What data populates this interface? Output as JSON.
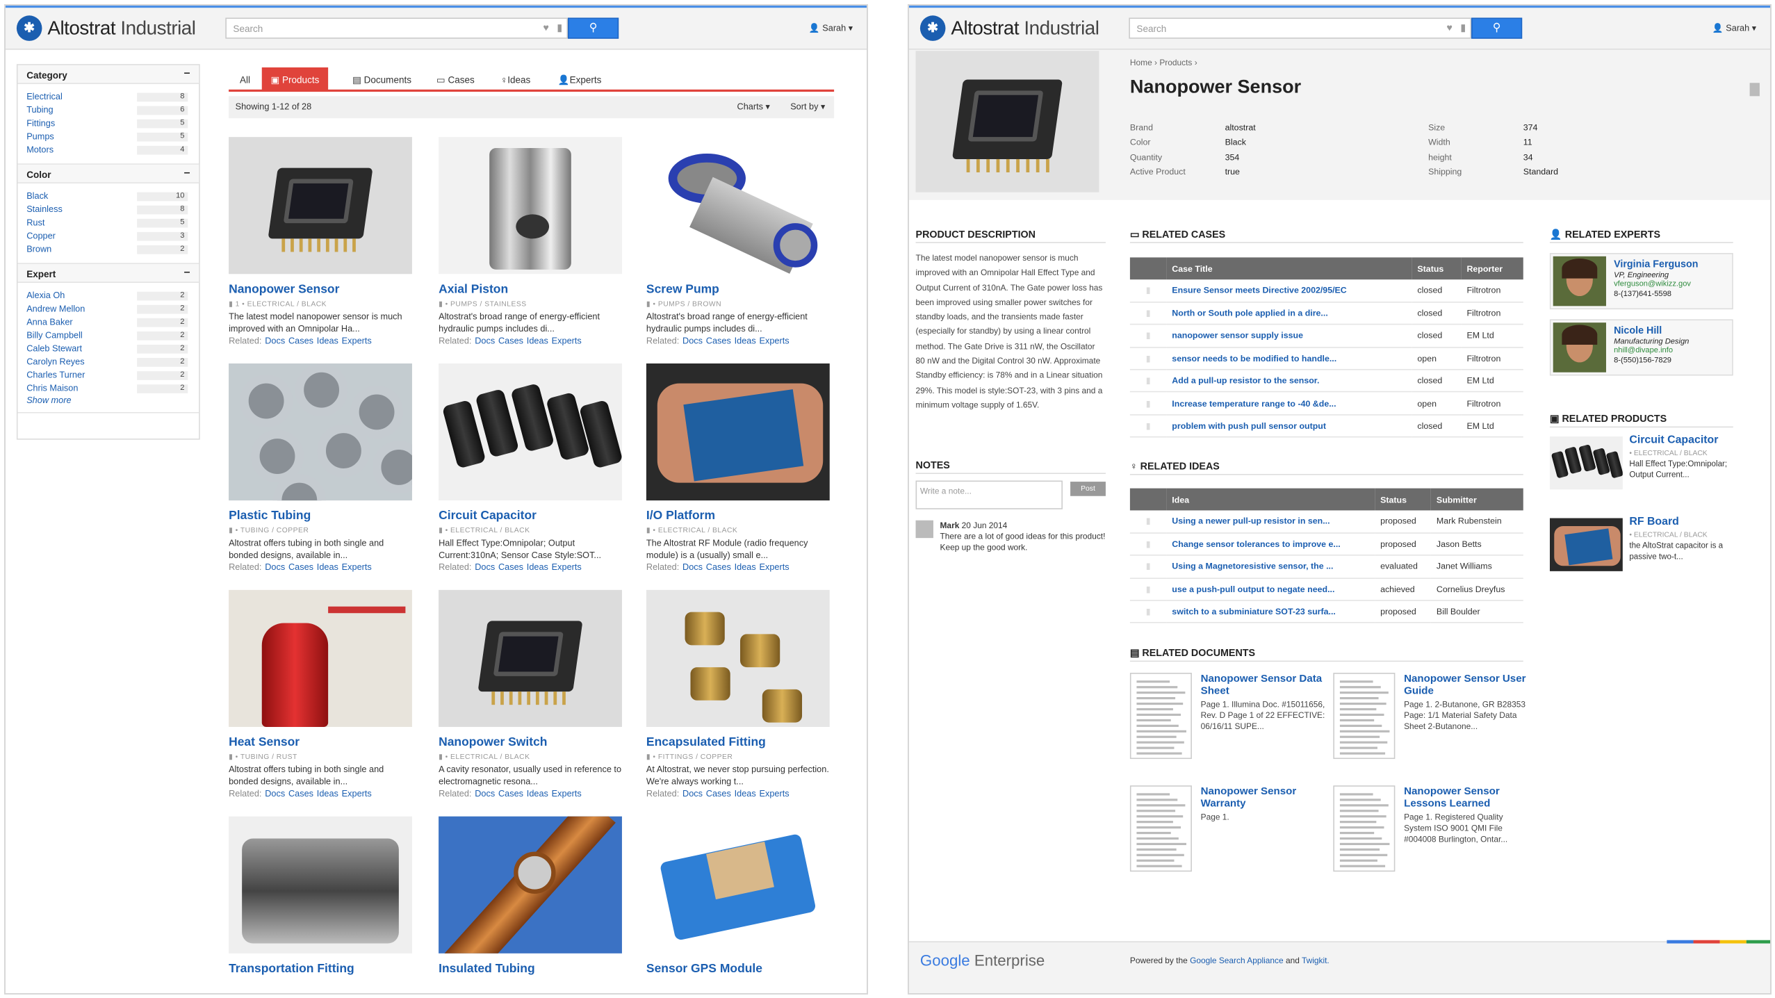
{
  "app": {
    "brand_main": "Altostrat",
    "brand_sub": "Industrial",
    "search_placeholder": "Search",
    "user": "Sarah"
  },
  "left": {
    "facets": [
      {
        "title": "Category",
        "items": [
          {
            "label": "Electrical",
            "count": "8"
          },
          {
            "label": "Tubing",
            "count": "6"
          },
          {
            "label": "Fittings",
            "count": "5"
          },
          {
            "label": "Pumps",
            "count": "5"
          },
          {
            "label": "Motors",
            "count": "4"
          }
        ]
      },
      {
        "title": "Color",
        "items": [
          {
            "label": "Black",
            "count": "10"
          },
          {
            "label": "Stainless",
            "count": "8"
          },
          {
            "label": "Rust",
            "count": "5"
          },
          {
            "label": "Copper",
            "count": "3"
          },
          {
            "label": "Brown",
            "count": "2"
          }
        ]
      },
      {
        "title": "Expert",
        "items": [
          {
            "label": "Alexia Oh",
            "count": "2"
          },
          {
            "label": "Andrew Mellon",
            "count": "2"
          },
          {
            "label": "Anna Baker",
            "count": "2"
          },
          {
            "label": "Billy Campbell",
            "count": "2"
          },
          {
            "label": "Caleb Stewart",
            "count": "2"
          },
          {
            "label": "Carolyn Reyes",
            "count": "2"
          },
          {
            "label": "Charles Turner",
            "count": "2"
          },
          {
            "label": "Chris Maison",
            "count": "2"
          }
        ]
      }
    ],
    "show_more": "Show more",
    "tabs": {
      "all": "All",
      "products": "Products",
      "documents": "Documents",
      "cases": "Cases",
      "ideas": "Ideas",
      "experts": "Experts"
    },
    "showing": "Showing 1-12 of 28",
    "charts": "Charts",
    "sort_by": "Sort by",
    "related_label": "Related:",
    "related_links": [
      "Docs",
      "Cases",
      "Ideas",
      "Experts"
    ],
    "products": [
      {
        "title": "Nanopower Sensor",
        "meta": "1 • ELECTRICAL / BLACK",
        "desc": "The latest model nanopower sensor is much improved with an Omnipolar Ha...",
        "img": "chip"
      },
      {
        "title": "Axial Piston",
        "meta": "• PUMPS / STAINLESS",
        "desc": "Altostrat's broad range of energy-efficient hydraulic pumps includes di...",
        "img": "piston"
      },
      {
        "title": "Screw Pump",
        "meta": "• PUMPS / BROWN",
        "desc": "Altostrat's broad range of energy-efficient hydraulic pumps includes di...",
        "img": "pump"
      },
      {
        "title": "Plastic Tubing",
        "meta": "• TUBING / COPPER",
        "desc": "Altostrat offers tubing in both single and bonded designs, available in...",
        "img": "tubing"
      },
      {
        "title": "Circuit Capacitor",
        "meta": "• ELECTRICAL / BLACK",
        "desc": "Hall Effect Type:Omnipolar; Output Current:310nA; Sensor Case Style:SOT...",
        "img": "caps"
      },
      {
        "title": "I/O Platform",
        "meta": "• ELECTRICAL / BLACK",
        "desc": "The Altostrat RF Module (radio frequency module) is a (usually) small e...",
        "img": "board"
      },
      {
        "title": "Heat Sensor",
        "meta": "• TUBING / RUST",
        "desc": "Altostrat offers tubing in both single and bonded designs, available in...",
        "img": "tank"
      },
      {
        "title": "Nanopower Switch",
        "meta": "• ELECTRICAL / BLACK",
        "desc": "A cavity resonator, usually used in reference to electromagnetic resona...",
        "img": "chip"
      },
      {
        "title": "Encapsulated Fitting",
        "meta": "• FITTINGS / COPPER",
        "desc": "At Altostrat, we never stop pursuing perfection. We're always working t...",
        "img": "fittings"
      },
      {
        "title": "Transportation Fitting",
        "meta": "",
        "desc": "",
        "img": "engine"
      },
      {
        "title": "Insulated Tubing",
        "meta": "",
        "desc": "",
        "img": "cable"
      },
      {
        "title": "Sensor GPS Module",
        "meta": "",
        "desc": "",
        "img": "gps"
      }
    ]
  },
  "right": {
    "breadcrumb": [
      "Home",
      "Products"
    ],
    "title": "Nanopower Sensor",
    "attrs_left": [
      {
        "k": "Brand",
        "v": "altostrat"
      },
      {
        "k": "Color",
        "v": "Black"
      },
      {
        "k": "Quantity",
        "v": "354"
      },
      {
        "k": "Active Product",
        "v": "true"
      }
    ],
    "attrs_right": [
      {
        "k": "Size",
        "v": "374"
      },
      {
        "k": "Width",
        "v": "11"
      },
      {
        "k": "height",
        "v": "34"
      },
      {
        "k": "Shipping",
        "v": "Standard"
      }
    ],
    "desc_heading": "PRODUCT DESCRIPTION",
    "description": "The latest model nanopower sensor is much improved with an Omnipolar Hall Effect Type and Output Current of 310nA. The Gate power loss has been improved using smaller power switches for standby loads, and the transients made faster (especially for standby) by using a linear control method. The Gate Drive is 311 nW, the Oscillator 80 nW and the Digital Control 30 nW. Approximate Standby efficiency: is 78% and in a Linear situation 29%. This model is style:SOT-23, with 3 pins and a minimum voltage supply of 1.65V.",
    "notes_heading": "NOTES",
    "note_placeholder": "Write a note...",
    "post": "Post",
    "note": {
      "author": "Mark",
      "date": "20 Jun 2014",
      "text": "There are a lot of good ideas for this product! Keep up the good work."
    },
    "cases_heading": "RELATED CASES",
    "cases_cols": [
      "Case Title",
      "Status",
      "Reporter"
    ],
    "cases": [
      [
        "Ensure Sensor meets Directive 2002/95/EC",
        "closed",
        "Filtrotron"
      ],
      [
        "North or South pole applied in a dire...",
        "closed",
        "Filtrotron"
      ],
      [
        "nanopower sensor supply issue",
        "closed",
        "EM Ltd"
      ],
      [
        "sensor needs to be modified to handle...",
        "open",
        "Filtrotron"
      ],
      [
        "Add a pull-up resistor to the sensor.",
        "closed",
        "EM Ltd"
      ],
      [
        "Increase temperature range to -40 &de...",
        "open",
        "Filtrotron"
      ],
      [
        "problem with push pull sensor output",
        "closed",
        "EM Ltd"
      ]
    ],
    "ideas_heading": "RELATED IDEAS",
    "ideas_cols": [
      "Idea",
      "Status",
      "Submitter"
    ],
    "ideas": [
      [
        "Using a newer pull-up resistor in sen...",
        "proposed",
        "Mark Rubenstein"
      ],
      [
        "Change sensor tolerances to improve e...",
        "proposed",
        "Jason Betts"
      ],
      [
        "Using a Magnetoresistive sensor, the ...",
        "evaluated",
        "Janet Williams"
      ],
      [
        "use a push-pull output to negate need...",
        "achieved",
        "Cornelius Dreyfus"
      ],
      [
        "switch to a subminiature SOT-23 surfa...",
        "proposed",
        "Bill Boulder"
      ]
    ],
    "docs_heading": "RELATED DOCUMENTS",
    "docs": [
      {
        "title": "Nanopower Sensor Data Sheet",
        "desc": "Page 1. Illumina Doc. #15011656, Rev. D Page 1 of 22 EFFECTIVE: 06/16/11 SUPE..."
      },
      {
        "title": "Nanopower Sensor User Guide",
        "desc": "Page 1. 2-Butanone, GR B28353 Page: 1/1 Material Safety Data Sheet 2-Butanone..."
      },
      {
        "title": "Nanopower Sensor Warranty",
        "desc": "Page 1."
      },
      {
        "title": "Nanopower Sensor Lessons Learned",
        "desc": "Page 1. Registered Quality System ISO 9001 QMI File #004008 Burlington, Ontar..."
      }
    ],
    "experts_heading": "RELATED EXPERTS",
    "experts": [
      {
        "name": "Virginia Ferguson",
        "role": "VP, Engineering",
        "email": "vferguson@wikizz.gov",
        "phone": "8-(137)641-5598"
      },
      {
        "name": "Nicole Hill",
        "role": "Manufacturing Design",
        "email": "nhill@divape.info",
        "phone": "8-(550)156-7829"
      }
    ],
    "products_heading": "RELATED PRODUCTS",
    "related_products": [
      {
        "title": "Circuit Capacitor",
        "meta": "• ELECTRICAL / BLACK",
        "desc": "Hall Effect Type:Omnipolar; Output Current..."
      },
      {
        "title": "RF Board",
        "meta": "• ELECTRICAL / BLACK",
        "desc": "the AltoStrat capacitor is a passive two-t..."
      }
    ],
    "footer_logo_google": "Google",
    "footer_logo_enterprise": "Enterprise",
    "powered_prefix": "Powered by the",
    "powered_link1": "Google Search Appliance",
    "powered_and": "and",
    "powered_link2": "Twigkit."
  },
  "colors": {
    "accent_red": "#e0433b",
    "link_blue": "#1b5eb0",
    "button_blue": "#2b7fe6"
  }
}
